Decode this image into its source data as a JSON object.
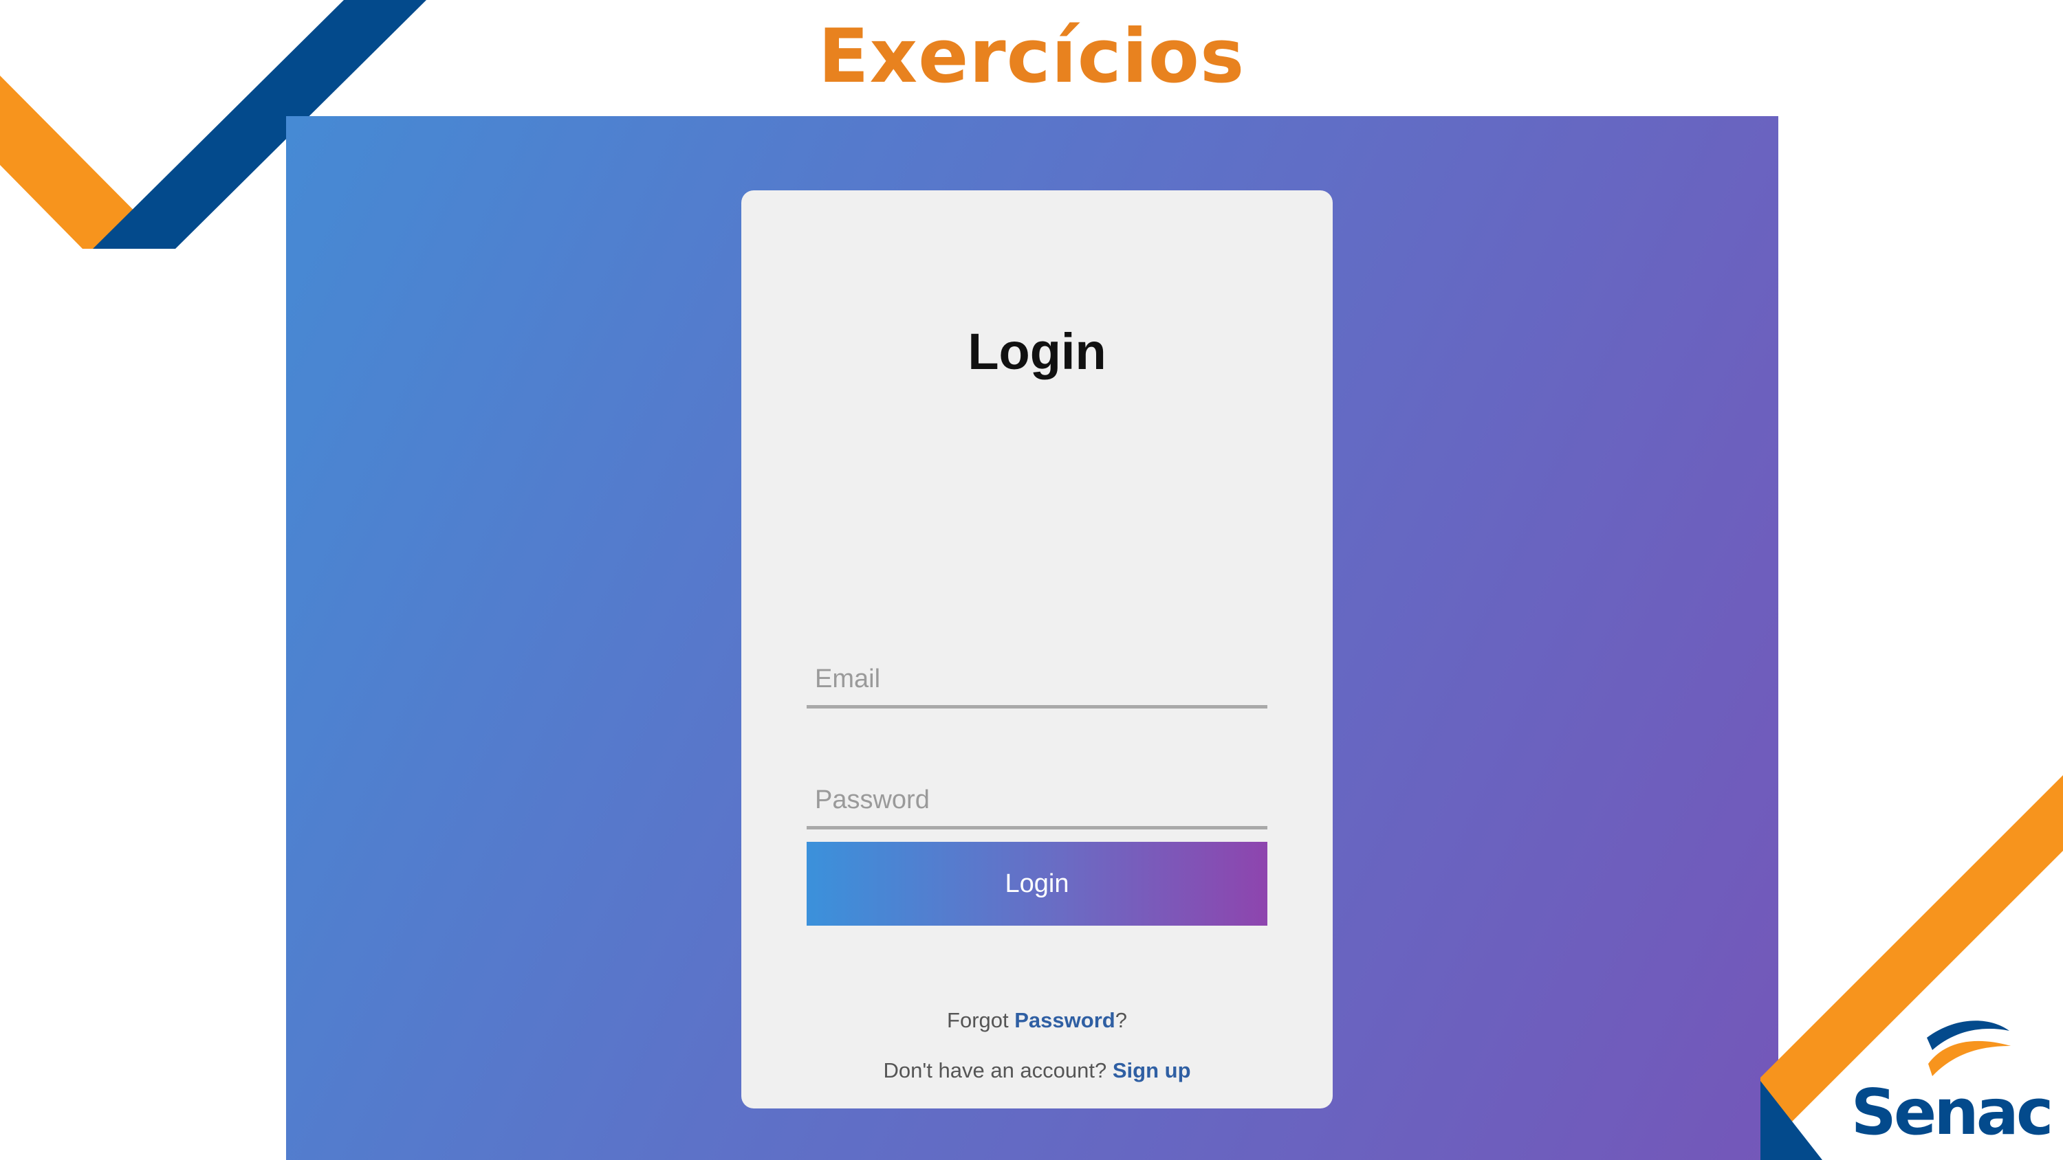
{
  "slide": {
    "title": "Exercícios"
  },
  "login_form": {
    "heading": "Login",
    "email_placeholder": "Email",
    "password_placeholder": "Password",
    "submit_label": "Login",
    "forgot_prefix": "Forgot ",
    "forgot_link": "Password",
    "forgot_suffix": "?",
    "signup_prefix": "Don't have an account? ",
    "signup_link": "Sign up"
  },
  "logo": {
    "text": "Senac"
  },
  "colors": {
    "title_orange": "#e8821f",
    "stripe_orange": "#f7941d",
    "stripe_navy": "#034a8c",
    "link_blue": "#2f5fa3",
    "gradient_start": "#468ad4",
    "gradient_end": "#7457b9"
  }
}
